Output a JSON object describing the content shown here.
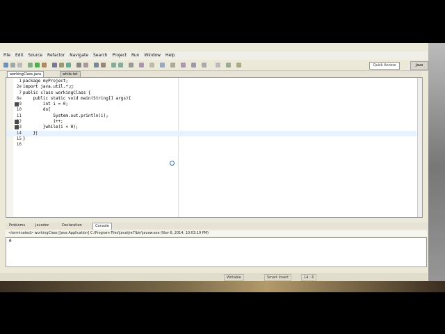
{
  "menu": {
    "items": [
      "File",
      "Edit",
      "Source",
      "Refactor",
      "Navigate",
      "Search",
      "Project",
      "Run",
      "Window",
      "Help"
    ]
  },
  "toolbar": {
    "quick_access": "Quick Access",
    "perspective": "Java"
  },
  "editor_tabs": [
    {
      "label": "workingClass.java",
      "active": true
    },
    {
      "label": "while.txt",
      "active": false
    }
  ],
  "code_lines": [
    {
      "num": "1",
      "text": "package myProject;"
    },
    {
      "num": "2⊕",
      "text": "import java.util.*;□"
    },
    {
      "num": "7",
      "text": "public class workingClass {"
    },
    {
      "num": "8⊖",
      "text": "    public static void main(String[] args){"
    },
    {
      "num": "9",
      "text": "        int i = 0;"
    },
    {
      "num": "10",
      "text": "        do{"
    },
    {
      "num": "11",
      "text": "            System.out.println(i);"
    },
    {
      "num": "12",
      "text": "            i++;"
    },
    {
      "num": "13",
      "text": "        }while(i < 0);"
    },
    {
      "num": "14",
      "text": "    }|"
    },
    {
      "num": "15",
      "text": "}"
    },
    {
      "num": "16",
      "text": ""
    }
  ],
  "bottom_tabs": [
    {
      "label": "Problems",
      "active": false
    },
    {
      "label": "Javadoc",
      "active": false
    },
    {
      "label": "Declaration",
      "active": false
    },
    {
      "label": "Console",
      "active": true
    }
  ],
  "console": {
    "header": "<terminated> workingClass [Java Application] C:\\Program Files\\Java\\jre7\\bin\\javaw.exe (Nov 6, 2014, 10:03:19 PM)",
    "output": "0"
  },
  "status": {
    "writable": "Writable",
    "insert_mode": "Smart Insert",
    "position": "14 : 6"
  },
  "colors": {
    "keyword": "#7f0055",
    "background": "#ece9d8"
  }
}
